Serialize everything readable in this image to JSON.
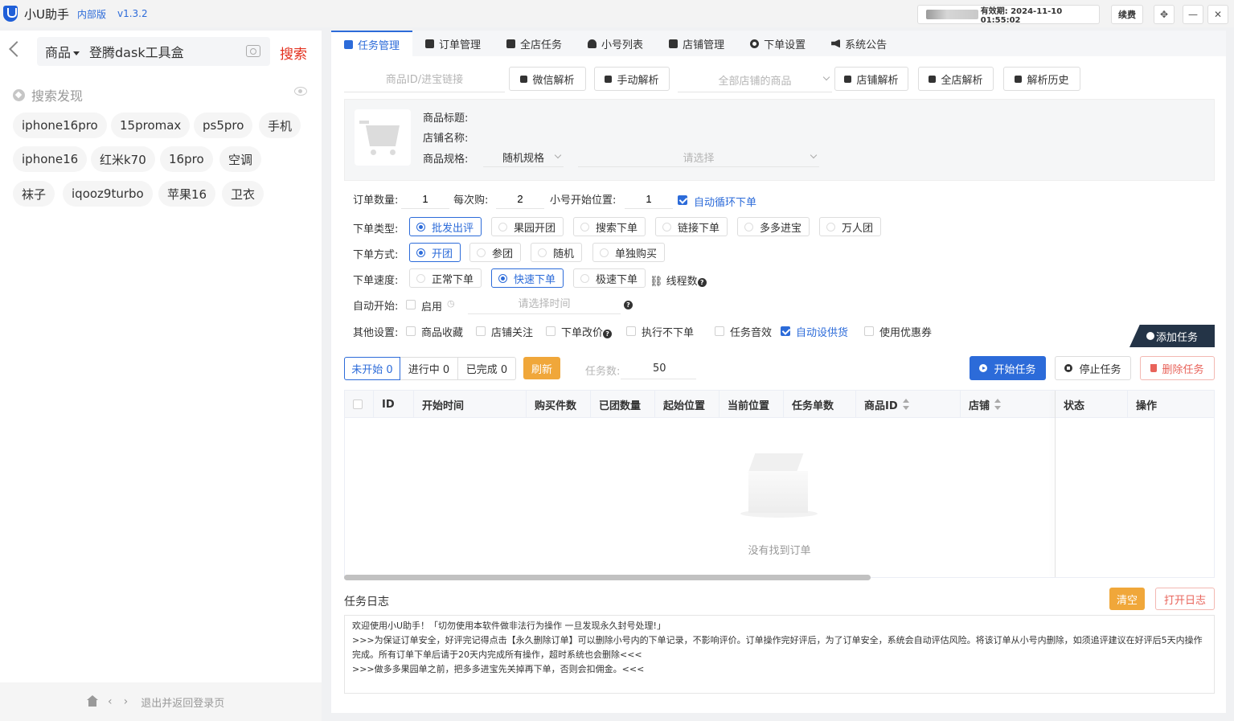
{
  "titlebar": {
    "app_name": "小U助手",
    "badge": "内部版",
    "version": "v1.3.2",
    "expire_label": "有效期: 2024-11-10 01:55:02",
    "renew_label": "续费",
    "move_icon": "move-icon",
    "minimize": "—",
    "close": "✕"
  },
  "left": {
    "search": {
      "category": "商品",
      "value": "登腾dask工具盒",
      "button": "搜索"
    },
    "discover_label": "搜索发现",
    "tags": [
      "iphone16pro",
      "15promax",
      "ps5pro",
      "手机",
      "iphone16",
      "红米k70",
      "16pro",
      "空调",
      "袜子",
      "iqooz9turbo",
      "苹果16",
      "卫衣"
    ],
    "footer_text": "退出并返回登录页"
  },
  "tabs": [
    {
      "label": "任务管理",
      "icon": "task-icon",
      "active": true
    },
    {
      "label": "订单管理",
      "icon": "order-icon"
    },
    {
      "label": "全店任务",
      "icon": "shop-task-icon"
    },
    {
      "label": "小号列表",
      "icon": "account-list-icon"
    },
    {
      "label": "店铺管理",
      "icon": "store-icon"
    },
    {
      "label": "下单设置",
      "icon": "gear-icon"
    },
    {
      "label": "系统公告",
      "icon": "speaker-icon"
    }
  ],
  "toolbar": {
    "link_placeholder": "商品ID/进宝链接",
    "wechat_parse": "微信解析",
    "manual_parse": "手动解析",
    "all_store_goods": "全部店铺的商品",
    "store_parse": "店铺解析",
    "all_store_parse": "全店解析",
    "parse_history": "解析历史"
  },
  "product": {
    "title_label": "商品标题:",
    "store_label": "店铺名称:",
    "spec_label": "商品规格:",
    "spec_value": "随机规格",
    "spec_placeholder": "请选择"
  },
  "form": {
    "order_qty_label": "订单数量:",
    "order_qty": "1",
    "per_buy_label": "每次购:",
    "per_buy": "2",
    "start_pos_label": "小号开始位置:",
    "start_pos": "1",
    "auto_loop_label": "自动循环下单",
    "order_type_label": "下单类型:",
    "order_types": [
      "批发出评",
      "果园开团",
      "搜索下单",
      "链接下单",
      "多多进宝",
      "万人团"
    ],
    "order_mode_label": "下单方式:",
    "order_modes": [
      "开团",
      "参团",
      "随机",
      "单独购买"
    ],
    "speed_label": "下单速度:",
    "speeds": [
      "正常下单",
      "快速下单",
      "极速下单"
    ],
    "threads_label": "线程数",
    "auto_start_label": "自动开始:",
    "enable_label": "启用",
    "time_placeholder": "请选择时间",
    "other_label": "其他设置:",
    "others": [
      "商品收藏",
      "店铺关注",
      "下单改价",
      "执行不下单",
      "任务音效",
      "自动设供货",
      "使用优惠券"
    ],
    "add_task": "添加任务"
  },
  "status": {
    "not_started": "未开始 0",
    "running": "进行中 0",
    "done": "已完成 0",
    "refresh": "刷新",
    "task_count_label": "任务数:",
    "task_count": "50",
    "start": "开始任务",
    "stop": "停止任务",
    "delete": "删除任务"
  },
  "table": {
    "columns": [
      "ID",
      "开始时间",
      "购买件数",
      "已团数量",
      "起始位置",
      "当前位置",
      "任务单数",
      "商品ID",
      "店铺",
      "状态",
      "操作"
    ],
    "empty_text": "没有找到订单"
  },
  "log": {
    "title": "任务日志",
    "clear": "清空",
    "open": "打开日志",
    "lines": [
      "欢迎使用小U助手！「切勿使用本软件做非法行为操作 一旦发现永久封号处理!」",
      ">>>为保证订单安全，好评完记得点击【永久删除订单】可以删除小号内的下单记录，不影响评价。订单操作完好评后，为了订单安全，系统会自动评估风险。将该订单从小号内删除，如须追评建议在好评后5天内操作完成。所有订单下单后请于20天内完成所有操作，超时系统也会删除<<<",
      ">>>做多多果园单之前，把多多进宝先关掉再下单，否则会扣佣金。<<<"
    ]
  },
  "colors": {
    "accent": "#2c6bd9",
    "warning": "#f0a73a",
    "danger": "#e8635a",
    "search": "#e3301e"
  }
}
